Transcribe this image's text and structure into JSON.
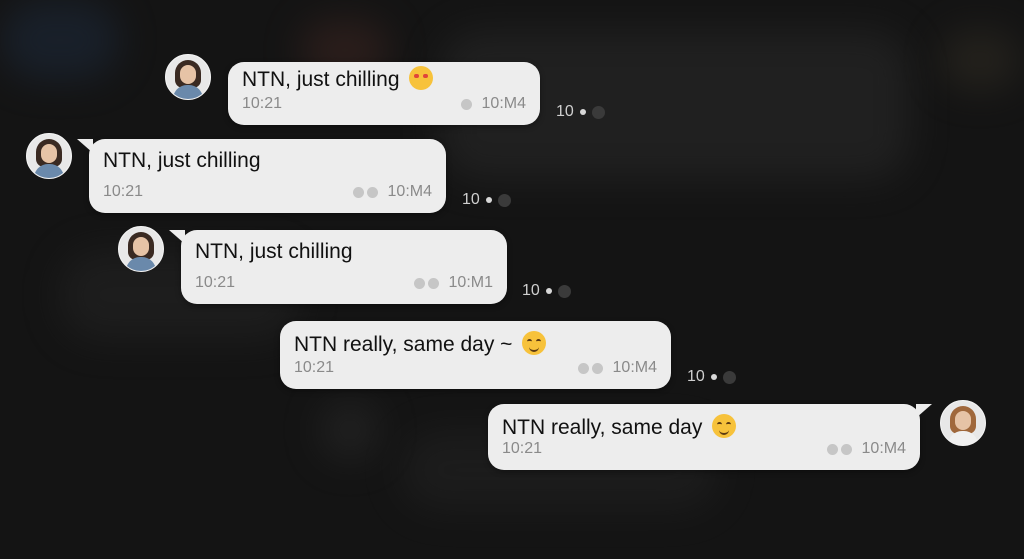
{
  "messages": [
    {
      "text": "NTN, just chilling",
      "time": "10:21",
      "status": "10:M4",
      "side_count": "10"
    },
    {
      "text": "NTN, just chilling",
      "time": "10:21",
      "status": "10:M4",
      "side_count": "10"
    },
    {
      "text": "NTN, just chilling",
      "time": "10:21",
      "status": "10:M1",
      "side_count": "10"
    },
    {
      "text": "NTN really, same day ~",
      "time": "10:21",
      "status": "10:M4",
      "side_count": "10"
    },
    {
      "text": "NTN really, same day",
      "time": "10:21",
      "status": "10:M4"
    }
  ],
  "emoji_names": [
    "heart-eyes-emoji",
    "smiling-emoji",
    "heart-smile-emoji"
  ],
  "colors": {
    "background": "#141414",
    "bubble": "#ededed",
    "meta_text": "#8a8a8a"
  }
}
